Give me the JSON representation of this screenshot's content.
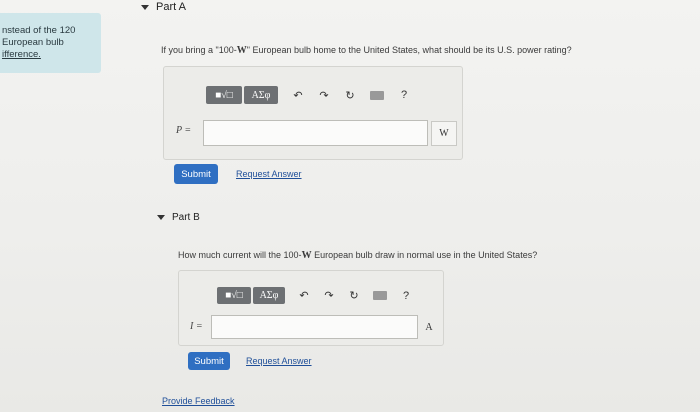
{
  "hint": {
    "lines": [
      "nstead of the 120",
      "European bulb",
      "ifference."
    ]
  },
  "partA": {
    "label": "Part A",
    "question": "If you bring a \"100-W\" European bulb home to the United States, what should be its U.S. power rating?",
    "q_pre": "If you bring a \"100-",
    "q_unit": "W",
    "q_post": "\" European bulb home to the United States, what should be its U.S. power rating?",
    "var": "P =",
    "unit": "W",
    "input_value": "",
    "submit": "Submit",
    "request": "Request Answer"
  },
  "partB": {
    "label": "Part B",
    "q_pre": "How much current will the 100-",
    "q_unit": "W",
    "q_post": " European bulb draw in normal use in the United States?",
    "var": "I =",
    "unit": "A",
    "input_value": "",
    "submit": "Submit",
    "request": "Request Answer"
  },
  "toolbar": {
    "template_label": "■√□",
    "symbols_label": "ΑΣφ",
    "undo": "↶",
    "redo": "↷",
    "reset": "↻",
    "help": "?"
  },
  "footer": {
    "feedback": "Provide Feedback"
  }
}
